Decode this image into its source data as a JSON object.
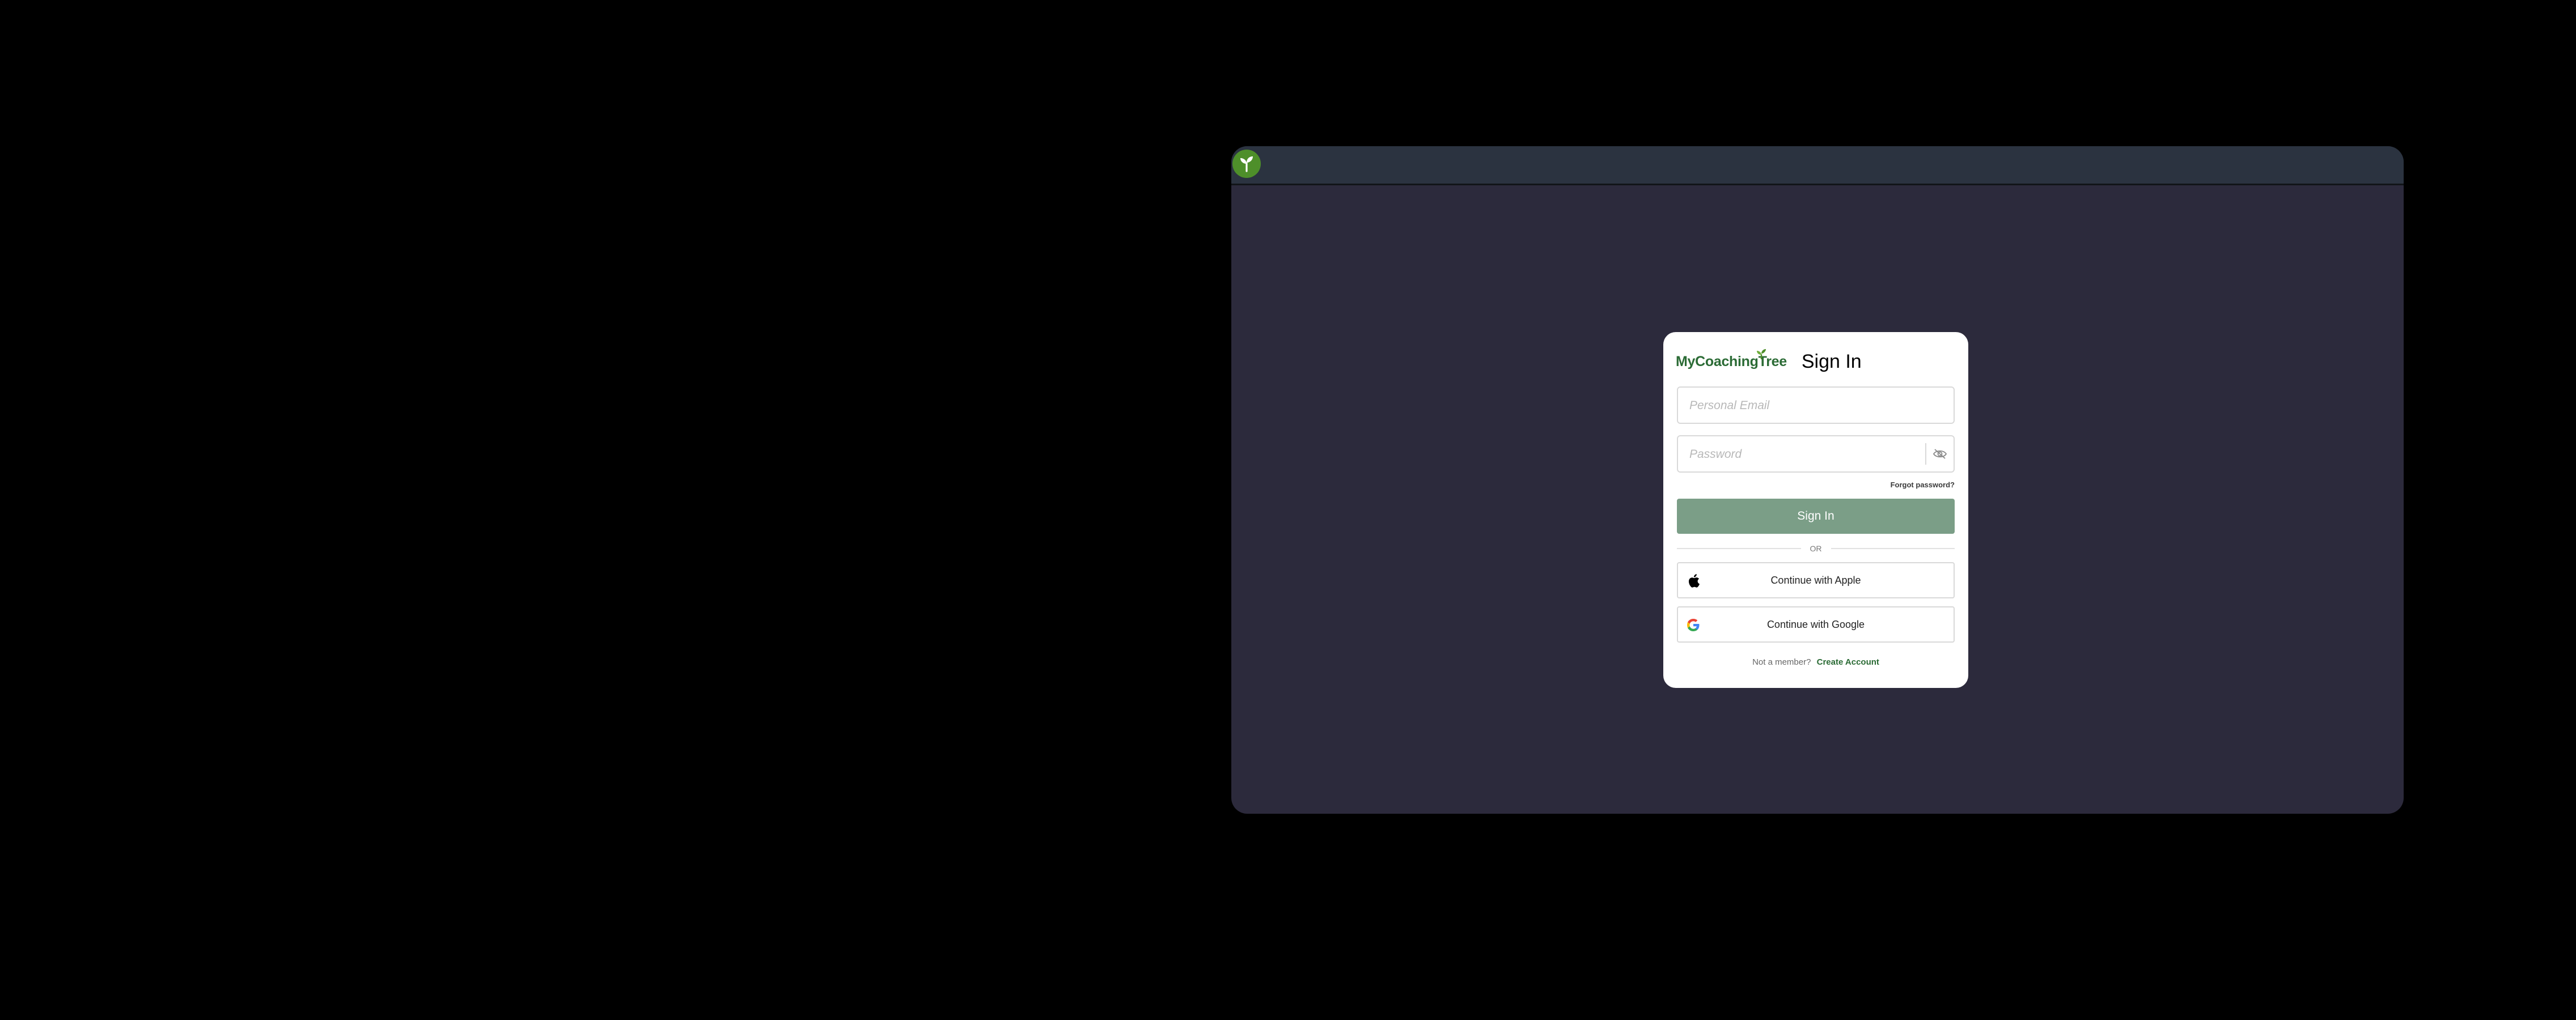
{
  "app": {
    "icon": "sprout-icon",
    "accent_color": "#4e8f2a"
  },
  "signin": {
    "logo_text": "MyCoachingTree",
    "logo_part1": "MyCoaching",
    "logo_part2": "Tree",
    "title": "Sign In",
    "email_placeholder": "Personal Email",
    "password_placeholder": "Password",
    "forgot_label": "Forgot password?",
    "submit_label": "Sign In",
    "submit_color": "#7b9e87",
    "or_label": "OR",
    "apple_label": "Continue with Apple",
    "google_label": "Continue with Google",
    "footer_prompt": "Not a member?",
    "create_label": "Create Account",
    "brand_color": "#2b6b35"
  }
}
